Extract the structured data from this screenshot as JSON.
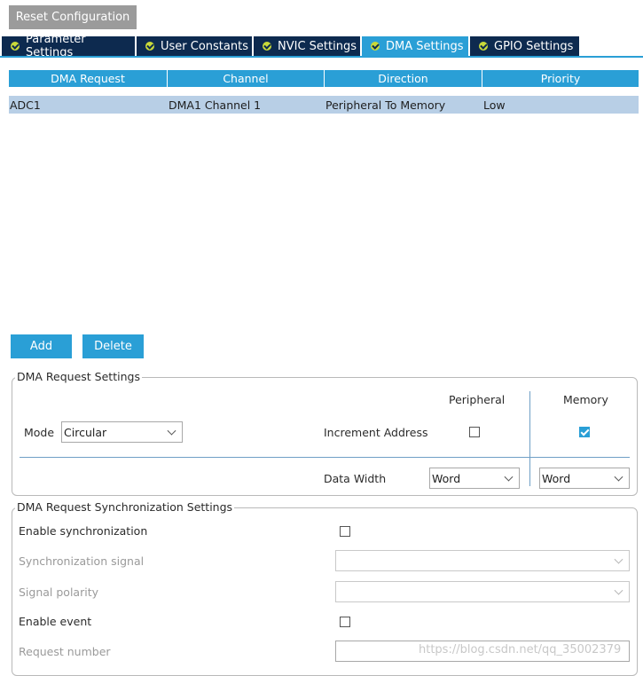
{
  "toolbar": {
    "reset_label": "Reset Configuration"
  },
  "tabs": [
    {
      "label": "Parameter Settings",
      "active": false
    },
    {
      "label": "User Constants",
      "active": false
    },
    {
      "label": "NVIC Settings",
      "active": false
    },
    {
      "label": "DMA Settings",
      "active": true
    },
    {
      "label": "GPIO Settings",
      "active": false
    }
  ],
  "dma_table": {
    "headers": [
      "DMA Request",
      "Channel",
      "Direction",
      "Priority"
    ],
    "rows": [
      {
        "request": "ADC1",
        "channel": "DMA1 Channel 1",
        "direction": "Peripheral To Memory",
        "priority": "Low"
      }
    ]
  },
  "actions": {
    "add_label": "Add",
    "delete_label": "Delete"
  },
  "request_settings": {
    "title": "DMA Request Settings",
    "peripheral_header": "Peripheral",
    "memory_header": "Memory",
    "mode_label": "Mode",
    "mode_value": "Circular",
    "increment_label": "Increment Address",
    "increment_peripheral": false,
    "increment_memory": true,
    "data_width_label": "Data Width",
    "data_width_peripheral": "Word",
    "data_width_memory": "Word"
  },
  "sync_settings": {
    "title": "DMA Request Synchronization Settings",
    "enable_sync_label": "Enable synchronization",
    "sync_signal_label": "Synchronization signal",
    "signal_polarity_label": "Signal polarity",
    "enable_event_label": "Enable event",
    "request_number_label": "Request number"
  },
  "watermark": "https://blog.csdn.net/qq_35002379",
  "colors": {
    "accent": "#2a9fd6",
    "tab_dark": "#0d2a4f",
    "row_selected": "#b8cfe6",
    "reset_gray": "#9b9b9b"
  }
}
